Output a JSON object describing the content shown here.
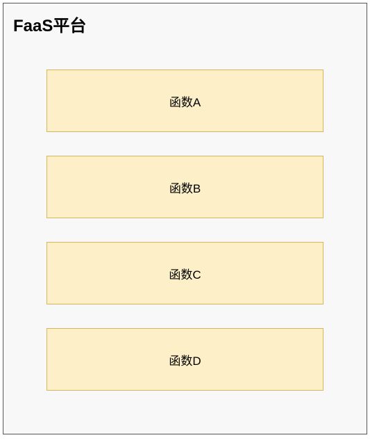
{
  "title": "FaaS平台",
  "functions": {
    "0": {
      "label": "函数A"
    },
    "1": {
      "label": "函数B"
    },
    "2": {
      "label": "函数C"
    },
    "3": {
      "label": "函数D"
    }
  }
}
